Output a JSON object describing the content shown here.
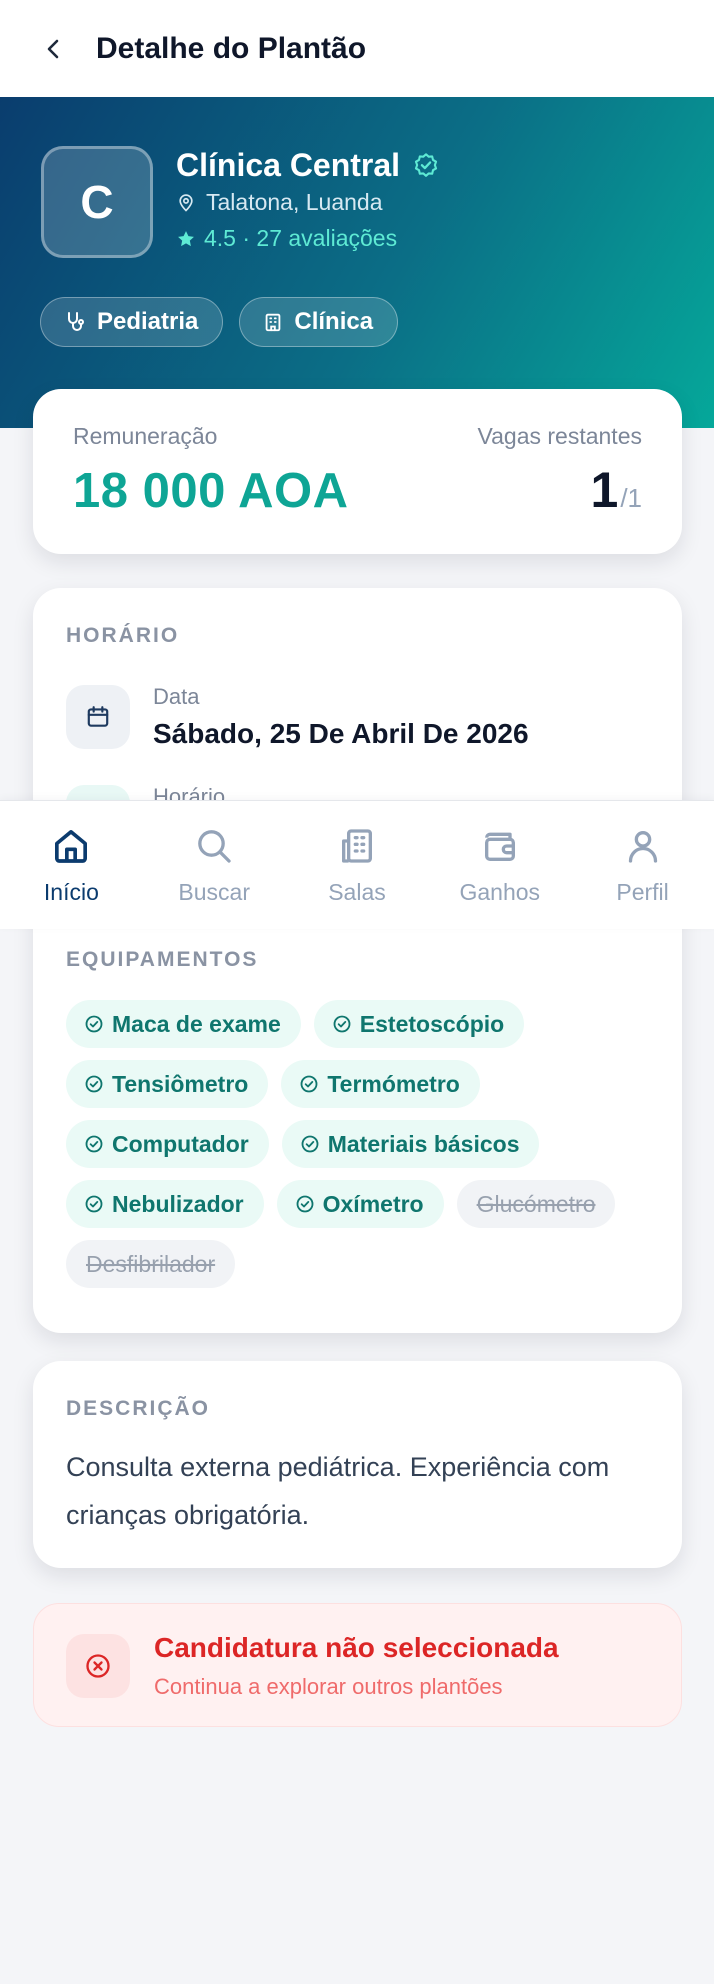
{
  "header": {
    "title": "Detalhe do Plantão"
  },
  "clinic": {
    "initial": "C",
    "name": "Clínica Central",
    "location": "Talatona, Luanda",
    "rating": "4.5 · 27 avaliações",
    "tags": [
      {
        "label": "Pediatria",
        "icon": "stethoscope-icon"
      },
      {
        "label": "Clínica",
        "icon": "building-icon"
      }
    ]
  },
  "pay": {
    "label": "Remuneração",
    "value": "18 000 AOA",
    "slots_label": "Vagas restantes",
    "slots_remaining": "1",
    "slots_total": "/1"
  },
  "schedule": {
    "title": "HORÁRIO",
    "date_label": "Data",
    "date_value": "Sábado, 25 De Abril De 2026",
    "time_label": "Horário"
  },
  "equipment": {
    "title": "EQUIPAMENTOS",
    "available": [
      "Maca de exame",
      "Estetoscópio",
      "Tensiômetro",
      "Termómetro",
      "Computador",
      "Materiais básicos",
      "Nebulizador",
      "Oxímetro"
    ],
    "unavailable": [
      "Glucómetro",
      "Desfibrilador"
    ]
  },
  "description": {
    "title": "DESCRIÇÃO",
    "text": "Consulta externa pediátrica. Experiência com crianças obrigatória."
  },
  "status": {
    "title": "Candidatura não seleccionada",
    "subtitle": "Continua a explorar outros plantões"
  },
  "nav": [
    {
      "label": "Início",
      "icon": "home-icon",
      "active": true
    },
    {
      "label": "Buscar",
      "icon": "search-icon",
      "active": false
    },
    {
      "label": "Salas",
      "icon": "buildings-icon",
      "active": false
    },
    {
      "label": "Ganhos",
      "icon": "wallet-icon",
      "active": false
    },
    {
      "label": "Perfil",
      "icon": "user-icon",
      "active": false
    }
  ],
  "colors": {
    "accent": "#0ea595",
    "brand": "#0b3b6e",
    "danger": "#dc2626"
  }
}
